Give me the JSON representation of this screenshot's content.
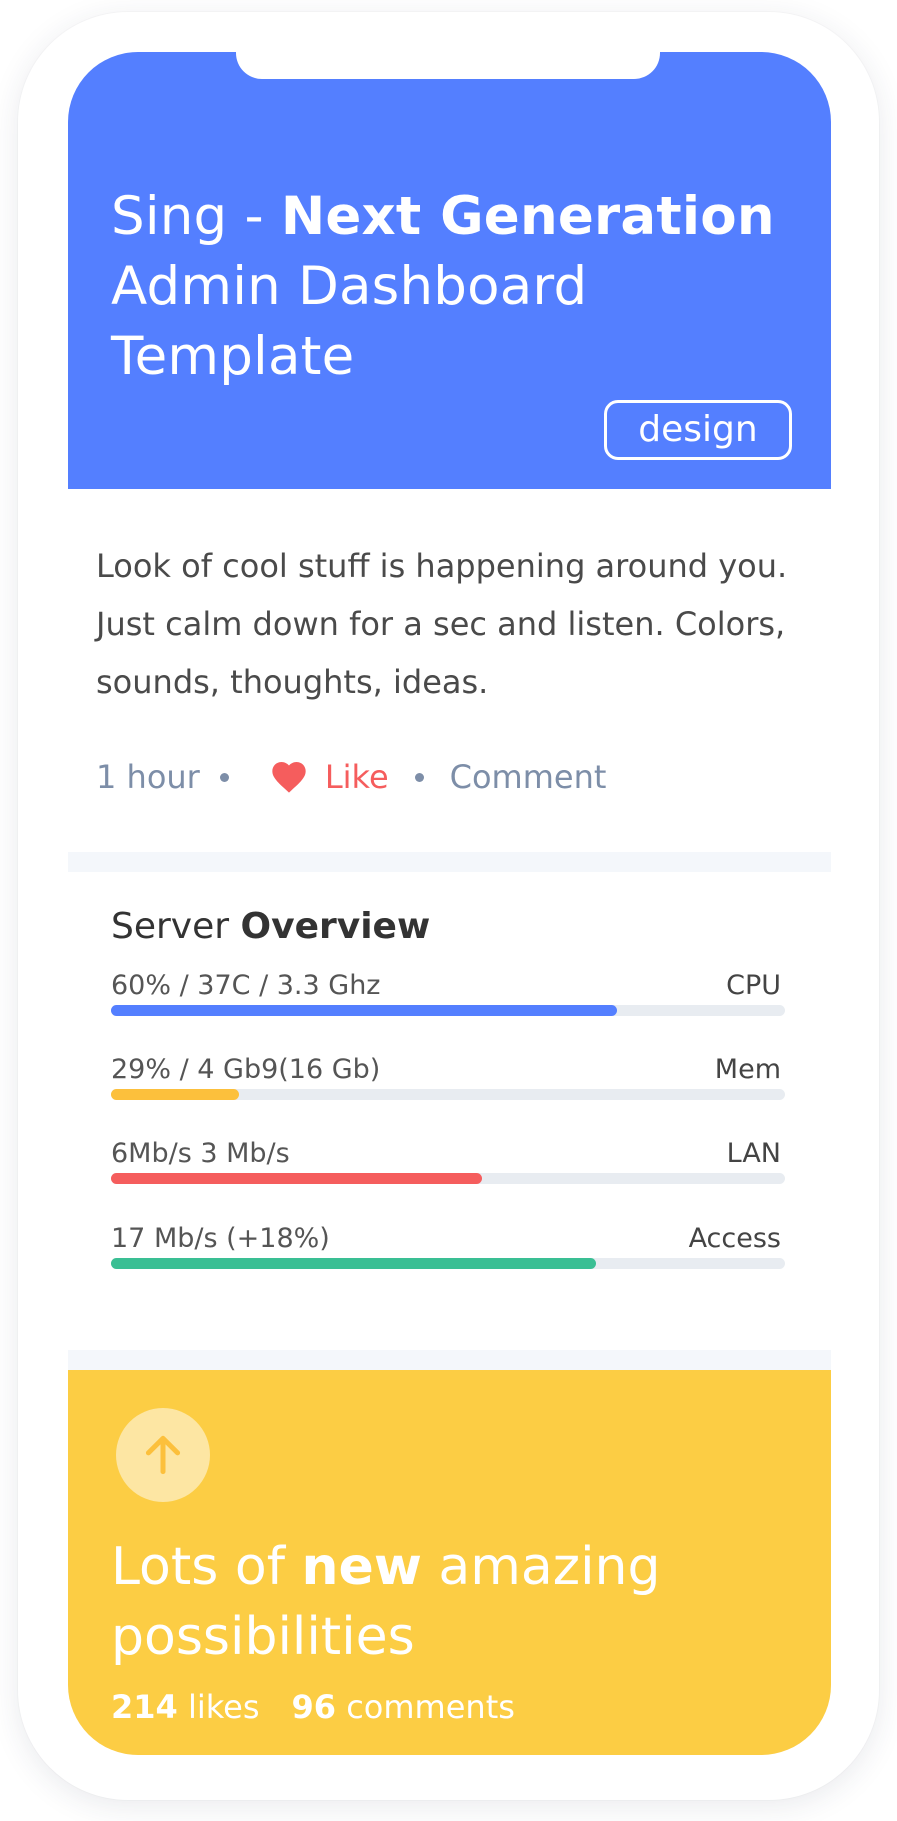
{
  "hero": {
    "title_prefix": "Sing - ",
    "title_bold": "Next Generation",
    "title_rest": "Admin Dashboard Template",
    "tag": "design",
    "bg_color": "#547fff"
  },
  "post": {
    "body": "Look of cool stuff is happening around you. Just calm down for a sec and listen. Colors, sounds, thoughts, ideas.",
    "time": "1 hour",
    "like_label": "Like",
    "comment_label": "Comment",
    "like_icon": "heart-icon",
    "like_color": "#f55d5d"
  },
  "server": {
    "title_prefix": "Server ",
    "title_bold": "Overview",
    "stats": [
      {
        "left": "60% / 37C / 3.3 Ghz",
        "right": "CPU",
        "progress": 0.75,
        "color": "#547fff"
      },
      {
        "left": "29% / 4 Gb9(16 Gb)",
        "right": "Mem",
        "progress": 0.19,
        "color": "#fcc03c"
      },
      {
        "left": "6Mb/s  3 Mb/s",
        "right": "LAN",
        "progress": 0.55,
        "color": "#f55d5d"
      },
      {
        "left": "17 Mb/s (+18%)",
        "right": "Access",
        "progress": 0.72,
        "color": "#3abf94"
      }
    ]
  },
  "promo": {
    "icon": "arrow-up-icon",
    "title_prefix": "Lots of ",
    "title_bold": "new",
    "title_rest": " amazing possibilities",
    "likes_count": "214",
    "likes_label": " likes",
    "comments_count": "96",
    "comments_label": " comments",
    "bg_color": "#fccd44"
  }
}
